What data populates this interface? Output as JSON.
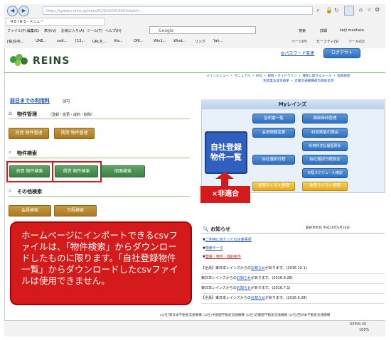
{
  "browser": {
    "url": "https://system.reins.jp/main/KG/GKG001000?siteId=...",
    "tab_title": "R E I N S - メニュー",
    "search_engine": "Google",
    "menu": [
      "ファイル(F)",
      "編集(E)",
      "表示(V)",
      "お気に入り(A)",
      "ツール(T)",
      "ヘルプ(H)"
    ],
    "favorites": [
      "[株]住宅...",
      "UNE...",
      "radi...",
      "[13...",
      "URLを...",
      "iHa...",
      "Offi...",
      "Win1...",
      "Wind...",
      "リンク",
      "Yah..."
    ],
    "right_tools": [
      "検索",
      "詳細",
      "keiji maeharа",
      "ページ(P)",
      "セーフティ(S)",
      "ツール(O)"
    ],
    "zoom": "100%",
    "footer_site": "REINS-40"
  },
  "header": {
    "logo_text": "REINS",
    "password_change": "パスワード変更",
    "logout": "ログアウト",
    "links": [
      "メインメニュー",
      "マニュアル",
      "FAQ",
      "規程・ガイドライン",
      "課金に関するルール",
      "会員規程",
      "宅建業法変更成果",
      "近畿流通機構運営規則変更"
    ]
  },
  "left": {
    "usage_fee_label": "前日までの利用料",
    "usage_fee_value": "0円",
    "property_mgmt_title": "物件管理",
    "property_mgmt_sub": "（登録・変更・成約・削除）",
    "btn_sell_mgmt": "売買 物件管理",
    "btn_rent_mgmt": "賃貸 物件管理",
    "property_search_title": "物件検索",
    "btn_sell_search": "売買 物件検索",
    "btn_rent_search": "賃貸 物件検索",
    "btn_map_search": "図面検索",
    "other_search_title": "その他検索",
    "btn_member_search": "会員検索",
    "btn_schedule_search": "日程検索"
  },
  "myreins": {
    "title": "Myレインズ",
    "own_list_btn": "自社登録物件一覧",
    "buttons_left": [
      "証明書一覧",
      "会員情報変更",
      "自社選択日程"
    ],
    "buttons_right": [
      "図面時時管理",
      "利用実績の照会",
      "利用料支払履歴照会",
      "自社選択日程設定",
      "日程スケジュール確認"
    ],
    "yellow_buttons": [
      "売買らくらく登録",
      "賃貸らくらく登録"
    ]
  },
  "annotation": {
    "not_suitable": "×非適合",
    "note": "ホームページにインポートできるcsvファイルは、「物件検索」からダウンロードしたものに限ります。「自社登録物件一覧」からダウンロードしたcsvファイルは使用できません。"
  },
  "news": {
    "title": "お知らせ",
    "updated": "最終更新日 平成28年9月28日",
    "links": [
      "ご利用にあたっての注意事項",
      "検索データ",
      "登録・物件・成約条件"
    ],
    "rows": [
      {
        "prefix": "【全員】東日本レインズからの",
        "link": "お知らせ",
        "suffix": "があります。(2016.10.1)"
      },
      {
        "prefix": "東日本レインズからの",
        "link": "お知らせ",
        "suffix": "があります。(2016.9.28)"
      },
      {
        "prefix": "東日本レインズからの",
        "link": "お知らせ",
        "suffix": "があります。(2016.7.1)"
      },
      {
        "prefix": "【全員】東日本レインズからの",
        "link": "お知らせ",
        "suffix": "があります。(2016.6.28)"
      }
    ]
  },
  "footer": {
    "orgs": "(公社)東日本不動産流通機構 (公社)中部圏不動産流通機構 (公社)近畿圏不動産流通機構 (公社)西日本不動産流通機構"
  }
}
